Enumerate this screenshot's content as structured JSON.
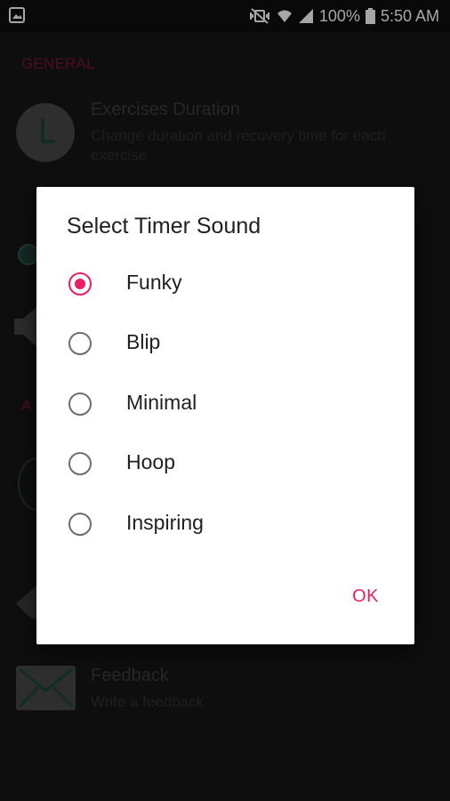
{
  "status_bar": {
    "battery_percent": "100%",
    "time": "5:50 AM",
    "icons": [
      "image-notification-icon",
      "mute-vibrate-icon",
      "wifi-icon",
      "signal-icon",
      "battery-icon"
    ]
  },
  "background": {
    "section_general": "GENERAL",
    "exercises_duration": {
      "title": "Exercises Duration",
      "subtitle": "Change duration and recovery time for each exercise"
    },
    "section_partial": "A",
    "feedback": {
      "title": "Feedback",
      "subtitle": "Write a feedback"
    }
  },
  "dialog": {
    "title": "Select Timer Sound",
    "options": [
      {
        "label": "Funky",
        "checked": true
      },
      {
        "label": "Blip",
        "checked": false
      },
      {
        "label": "Minimal",
        "checked": false
      },
      {
        "label": "Hoop",
        "checked": false
      },
      {
        "label": "Inspiring",
        "checked": false
      }
    ],
    "ok_label": "OK"
  },
  "colors": {
    "accent": "#e91e63",
    "dialog_bg": "#ffffff",
    "screen_bg": "#161616"
  }
}
